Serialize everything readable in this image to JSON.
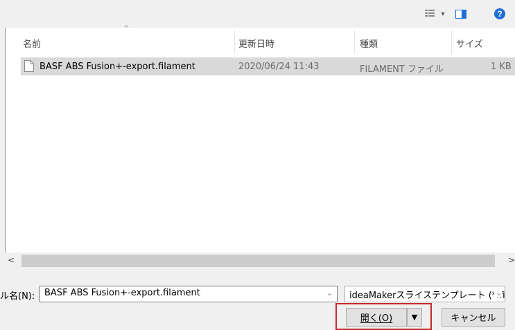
{
  "toolbar": {
    "view_dropdown_arrow": "▾",
    "help_label": "?",
    "icons": [
      "view-menu-icon",
      "preview-pane-icon",
      "help-icon"
    ]
  },
  "columns": {
    "sort_indicator": "^",
    "name": "名前",
    "date": "更新日時",
    "type": "種類",
    "size": "サイズ"
  },
  "files": [
    {
      "name": "BASF ABS Fusion+-export.filament",
      "date": "2020/06/24 11:43",
      "type": "FILAMENT ファイル",
      "size": "1 KB"
    }
  ],
  "scrollbar": {
    "left_arrow": "<",
    "right_arrow": ">"
  },
  "filename": {
    "label": "ル名(N):",
    "value": "BASF ABS Fusion+-export.filament",
    "dropdown_arrow": "⌄"
  },
  "filter": {
    "value": "ideaMakerスライステンプレート (*.fil",
    "dropdown_arrow": "⌄"
  },
  "buttons": {
    "open": "開く(O)",
    "open_menu_arrow": "▼",
    "cancel": "キャンセル"
  },
  "colors": {
    "accent_help": "#1e6fd6",
    "selection": "#d9d9d9",
    "highlight_border": "#c8282a"
  }
}
